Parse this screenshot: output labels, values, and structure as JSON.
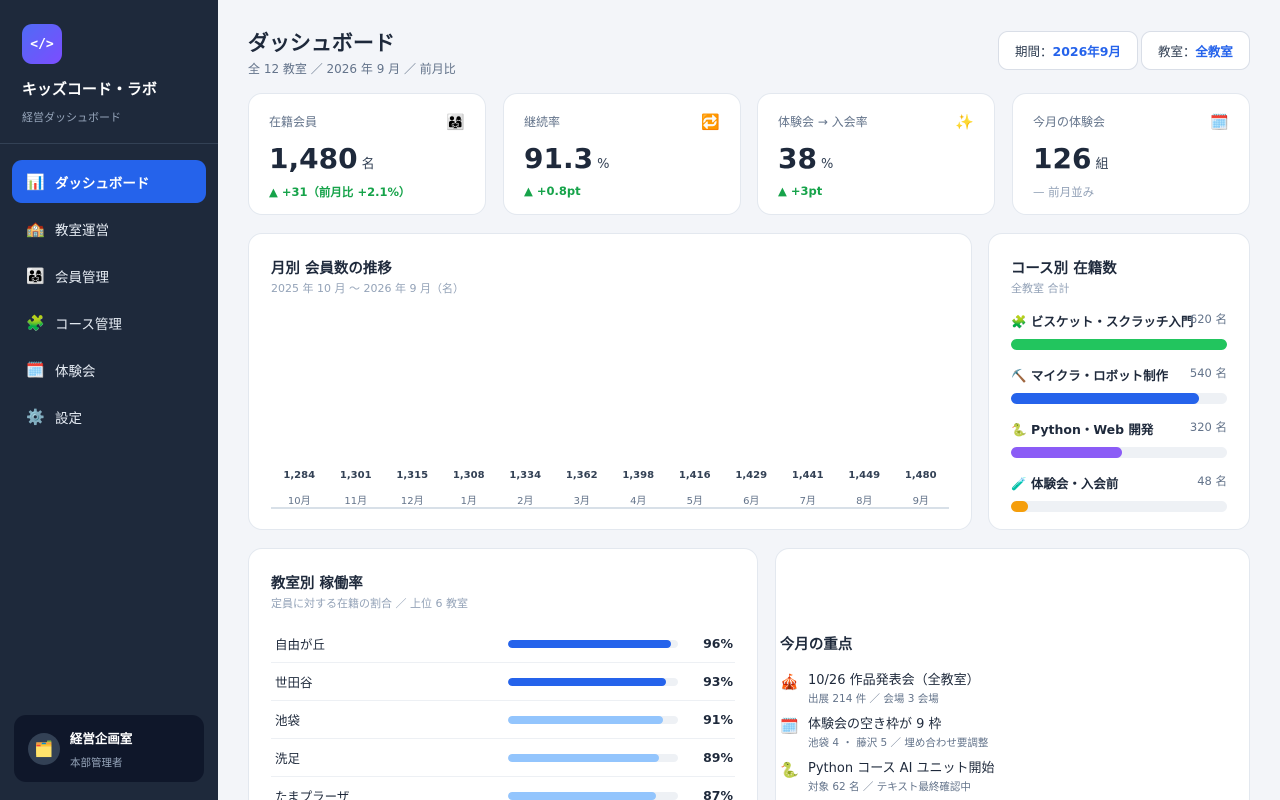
{
  "brand": {
    "logo": "</>",
    "name": "キッズコード・ラボ",
    "subtitle": "経営ダッシュボード"
  },
  "nav": [
    {
      "label": "ダッシュボード",
      "icon": "📊",
      "active": true
    },
    {
      "label": "教室運営",
      "icon": "🏫"
    },
    {
      "label": "会員管理",
      "icon": "👨‍👩‍👧"
    },
    {
      "label": "コース管理",
      "icon": "🧩"
    },
    {
      "label": "体験会",
      "icon": "🗓️"
    },
    {
      "label": "設定",
      "icon": "⚙️"
    }
  ],
  "user": {
    "icon": "🗂️",
    "name": "経営企画室",
    "role": "本部管理者"
  },
  "header": {
    "title": "ダッシュボード",
    "subtitle": "全 12 教室 ／ 2026 年 9 月 ／ 前月比",
    "period_label": "期間：",
    "period_value": "2026年9月",
    "room_label": "教室：",
    "room_value": "全教室"
  },
  "kpis": [
    {
      "label": "在籍会員",
      "icon": "👨‍👩‍👧",
      "value": "1,480",
      "unit": "名",
      "change": "▲ +31（前月比 +2.1%）",
      "trend": "up"
    },
    {
      "label": "継続率",
      "icon": "🔁",
      "value": "91.3",
      "unit": "%",
      "change": "▲ +0.8pt",
      "trend": "up"
    },
    {
      "label": "体験会 → 入会率",
      "icon": "✨",
      "value": "38",
      "unit": "%",
      "change": "▲ +3pt",
      "trend": "up"
    },
    {
      "label": "今月の体験会",
      "icon": "🗓️",
      "value": "126",
      "unit": "組",
      "change": "— 前月並み",
      "trend": "flat"
    }
  ],
  "members_chart": {
    "title": "月別 会員数の推移",
    "subtitle": "2025 年 10 月 〜 2026 年 9 月（名）"
  },
  "chart_data": {
    "type": "bar",
    "categories": [
      "10月",
      "11月",
      "12月",
      "1月",
      "2月",
      "3月",
      "4月",
      "5月",
      "6月",
      "7月",
      "8月",
      "9月"
    ],
    "values": [
      1284,
      1301,
      1315,
      1308,
      1334,
      1362,
      1398,
      1416,
      1429,
      1441,
      1449,
      1480
    ],
    "value_labels": [
      "1,284",
      "1,301",
      "1,315",
      "1,308",
      "1,334",
      "1,362",
      "1,398",
      "1,416",
      "1,429",
      "1,441",
      "1,449",
      "1,480"
    ],
    "title": "月別 会員数の推移"
  },
  "courses": {
    "title": "コース別 在籍数",
    "subtitle": "全教室 合計",
    "items": [
      {
        "icon": "🧩",
        "name": "ビスケット・スクラッチ入門",
        "count": "620 名",
        "value": 620,
        "color": "#22c55e"
      },
      {
        "icon": "⛏️",
        "name": "マイクラ・ロボット制作",
        "count": "540 名",
        "value": 540,
        "color": "#2563eb"
      },
      {
        "icon": "🐍",
        "name": "Python・Web 開発",
        "count": "320 名",
        "value": 320,
        "color": "#8b5cf6"
      },
      {
        "icon": "🧪",
        "name": "体験会・入会前",
        "count": "48 名",
        "value": 48,
        "color": "#f59e0b"
      }
    ],
    "max": 620
  },
  "rooms": {
    "title": "教室別 稼働率",
    "subtitle": "定員に対する在籍の割合 ／ 上位 6 教室",
    "items": [
      {
        "name": "自由が丘",
        "pct": "96%",
        "value": 96,
        "color": "#2563eb"
      },
      {
        "name": "世田谷",
        "pct": "93%",
        "value": 93,
        "color": "#2563eb"
      },
      {
        "name": "池袋",
        "pct": "91%",
        "value": 91,
        "color": "#93c5fd"
      },
      {
        "name": "洗足",
        "pct": "89%",
        "value": 89,
        "color": "#93c5fd"
      },
      {
        "name": "たまプラーザ",
        "pct": "87%",
        "value": 87,
        "color": "#93c5fd"
      }
    ]
  },
  "focus": {
    "title": "今月の重点",
    "items": [
      {
        "icon": "🎪",
        "main": "10/26 作品発表会（全教室）",
        "sub": "出展 214 件 ／ 会場 3 会場"
      },
      {
        "icon": "🗓️",
        "main": "体験会の空き枠が 9 枠",
        "sub": "池袋 4 ・ 藤沢 5 ／ 埋め合わせ要調整"
      },
      {
        "icon": "🐍",
        "main": "Python コース AI ユニット開始",
        "sub": "対象 62 名 ／ テキスト最終確認中"
      }
    ]
  }
}
